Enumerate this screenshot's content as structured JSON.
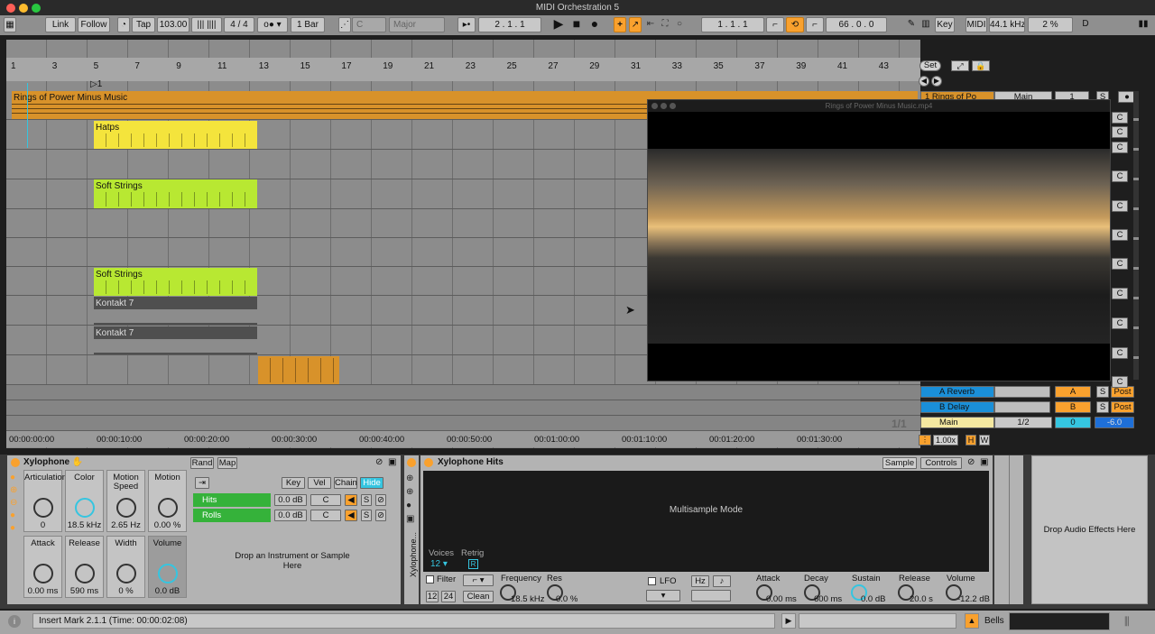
{
  "window": {
    "title": "MIDI Orchestration 5"
  },
  "control_bar": {
    "link": "Link",
    "follow": "Follow",
    "tap": "Tap",
    "tempo": "103.00",
    "signature": "4 / 4",
    "quantize": "1 Bar",
    "key": "C",
    "scale": "Major",
    "position": "2 .  1 .  1",
    "loop_start": "1 .  1 .  1",
    "loop_length": "66 .  0 .  0",
    "key_label": "Key",
    "midi_label": "MIDI",
    "sample_rate": "44.1 kHz",
    "cpu": "2 %"
  },
  "ruler": {
    "bars": [
      "1",
      "3",
      "5",
      "7",
      "9",
      "11",
      "13",
      "15",
      "17",
      "19",
      "21",
      "23",
      "25",
      "27",
      "29",
      "31",
      "33",
      "35",
      "37",
      "39",
      "41",
      "43"
    ],
    "set_button": "Set",
    "marker": "1"
  },
  "clips": {
    "main": "Rings of Power Minus Music",
    "hatps": "Hatps",
    "soft_strings_1": "Soft Strings",
    "soft_strings_2": "Soft Strings",
    "kontakt_1": "Kontakt 7",
    "kontakt_2": "Kontakt 7"
  },
  "time_axis": [
    "00:00:00:00",
    "00:00:10:00",
    "00:00:20:00",
    "00:00:30:00",
    "00:00:40:00",
    "00:00:50:00",
    "00:01:00:00",
    "00:01:10:00",
    "00:01:20:00",
    "00:01:30:00"
  ],
  "mixer": {
    "track1": "1 Rings of Po",
    "track1_route": "Main",
    "track1_num": "1",
    "return_a": "A Reverb",
    "return_a_send": "A",
    "return_b": "B Delay",
    "return_b_send": "B",
    "main": "Main",
    "main_route": "1/2",
    "main_vol": "0",
    "main_db": "-6.0",
    "page": "1/1",
    "zoom": "1.00x",
    "h": "H",
    "w": "W",
    "solo": "S",
    "post": "Post",
    "clip_c": "C"
  },
  "video": {
    "title": "Rings of Power Minus Music.mp4"
  },
  "rack": {
    "name": "Xylophone",
    "rand": "Rand",
    "map": "Map",
    "macros": [
      {
        "name": "Articulation",
        "value": "0"
      },
      {
        "name": "Color",
        "value": "18.5 kHz"
      },
      {
        "name": "Motion Speed",
        "value": "2.65 Hz"
      },
      {
        "name": "Motion",
        "value": "0.00 %"
      },
      {
        "name": "Attack",
        "value": "0.00 ms"
      },
      {
        "name": "Release",
        "value": "590 ms"
      },
      {
        "name": "Width",
        "value": "0 %"
      },
      {
        "name": "Volume",
        "value": "0.0 dB"
      }
    ],
    "chain_tabs": [
      "Key",
      "Vel",
      "Chain",
      "Hide"
    ],
    "chains": [
      {
        "name": "Hits",
        "db": "0.0 dB",
        "pan": "C"
      },
      {
        "name": "Rolls",
        "db": "0.0 dB",
        "pan": "C"
      }
    ],
    "drop_hint": "Drop an Instrument or Sample Here",
    "chain_name_vertical": "Xylophone..."
  },
  "sampler": {
    "name": "Xylophone Hits",
    "tab_sample": "Sample",
    "tab_controls": "Controls",
    "mode": "Multisample Mode",
    "voices_label": "Voices",
    "voices": "12",
    "retrig_label": "Retrig",
    "retrig": "R",
    "filter": "Filter",
    "filter_db1": "12",
    "filter_db2": "24",
    "filter_circuit": "Clean",
    "frequency_label": "Frequency",
    "frequency": "18.5 kHz",
    "res_label": "Res",
    "res": "0.0 %",
    "lfo": "LFO",
    "hz": "Hz",
    "attack_label": "Attack",
    "attack": "0.00 ms",
    "decay_label": "Decay",
    "decay": "600 ms",
    "sustain_label": "Sustain",
    "sustain": "0.0 dB",
    "release_label": "Release",
    "release": "20.0 s",
    "volume_label": "Volume",
    "volume": "-12.2 dB"
  },
  "effects_drop": "Drop Audio Effects Here",
  "status": {
    "text": "Insert Mark 2.1.1 (Time: 00:00:02:08)",
    "track": "Bells"
  },
  "colors": {
    "accent": "#f9a12e",
    "cyan": "#35c5e0",
    "clip_orange": "#d8922a",
    "clip_yellow": "#f4e43c",
    "clip_lime": "#b8e832",
    "clip_gray": "#4f4f4f"
  }
}
